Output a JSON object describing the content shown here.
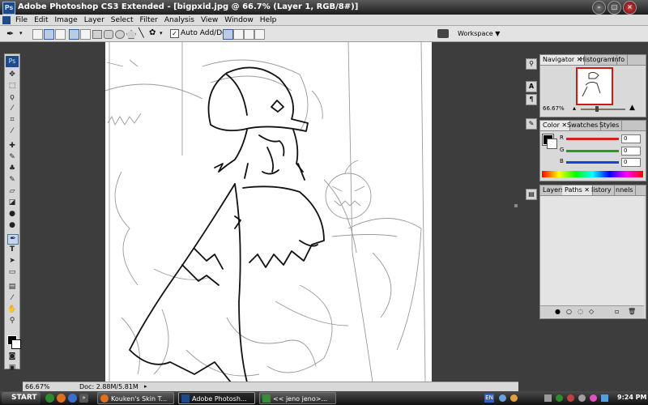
{
  "window": {
    "title": "Adobe Photoshop CS3 Extended - [bigpxid.jpg @ 66.7% (Layer 1, RGB/8#)]",
    "logo_text": "Ps"
  },
  "menu": [
    "File",
    "Edit",
    "Image",
    "Layer",
    "Select",
    "Filter",
    "Analysis",
    "View",
    "Window",
    "Help"
  ],
  "options": {
    "auto_add_delete_label": "Auto Add/Delete",
    "auto_add_delete_checked": true,
    "workspace_label": "Workspace ▼"
  },
  "tools": {
    "logo_text": "Ps",
    "items": [
      "move",
      "marquee",
      "lasso",
      "magic-wand",
      "crop",
      "slice",
      "healing",
      "brush",
      "stamp",
      "history-brush",
      "eraser",
      "gradient",
      "blur",
      "dodge",
      "pen",
      "type",
      "path-select",
      "shape",
      "notes",
      "eyedropper",
      "hand",
      "zoom"
    ],
    "active": "pen"
  },
  "status": {
    "zoom": "66.67%",
    "doc": "Doc: 2.88M/5.81M"
  },
  "navigator": {
    "tabs": [
      "Navigator",
      "Histogram",
      "Info"
    ],
    "zoom": "66.67%"
  },
  "color_panel": {
    "tabs": [
      "Color",
      "Swatches",
      "Styles"
    ],
    "channels": [
      {
        "label": "R",
        "value": "0",
        "color": "#d42020"
      },
      {
        "label": "G",
        "value": "0",
        "color": "#20a020"
      },
      {
        "label": "B",
        "value": "0",
        "color": "#2040d0"
      }
    ]
  },
  "layers_panel": {
    "tabs": [
      "Layers",
      "Paths",
      "History",
      "Channels"
    ],
    "tab_display": [
      "Layers",
      "Paths",
      "listory",
      "nnels"
    ]
  },
  "taskbar": {
    "start_label": "START",
    "tasks": [
      {
        "label": "Kouken's Skin T...",
        "active": false
      },
      {
        "label": "Adobe Photosh...",
        "active": true
      },
      {
        "label": "<< jeno jeno>...",
        "active": false
      }
    ],
    "lang": "EN",
    "clock": "9:24 PM"
  }
}
